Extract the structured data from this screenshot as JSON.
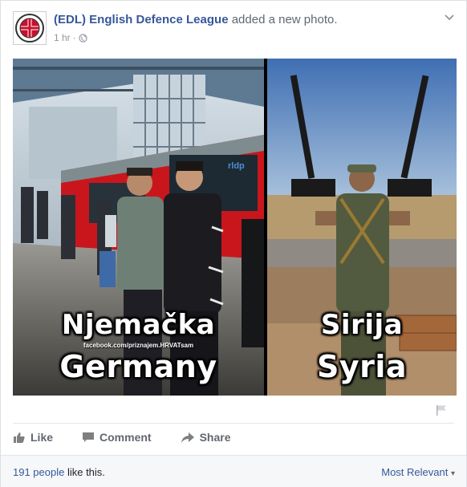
{
  "post": {
    "page_name": "(EDL) English Defence League",
    "action": "added a new photo.",
    "time": "1 hr",
    "separator": "·",
    "avatar_text_top": "ENGLISH",
    "avatar_text_mid": "DEFENCE",
    "avatar_text_bottom": "LEAGUE",
    "privacy_icon": "globe-icon",
    "menu_icon": "chevron-down-icon"
  },
  "photo": {
    "left_caption_line1": "Njemačka",
    "left_caption_line2": "Germany",
    "watermark": "facebook.com/priznajem.HRVATsam",
    "right_caption_line1": "Sirija",
    "right_caption_line2": "Syria",
    "train_sign": "rldp"
  },
  "actions": {
    "like": "Like",
    "comment": "Comment",
    "share": "Share",
    "like_icon": "thumbs-up-icon",
    "comment_icon": "speech-bubble-icon",
    "share_icon": "share-arrow-icon",
    "flag_icon": "flag-icon"
  },
  "footer": {
    "likes_count": "191 people",
    "likes_suffix": " like this.",
    "sort_label": "Most Relevant",
    "sort_caret": "▾"
  },
  "colors": {
    "link": "#365899",
    "muted": "#616770",
    "text": "#1d2129"
  }
}
